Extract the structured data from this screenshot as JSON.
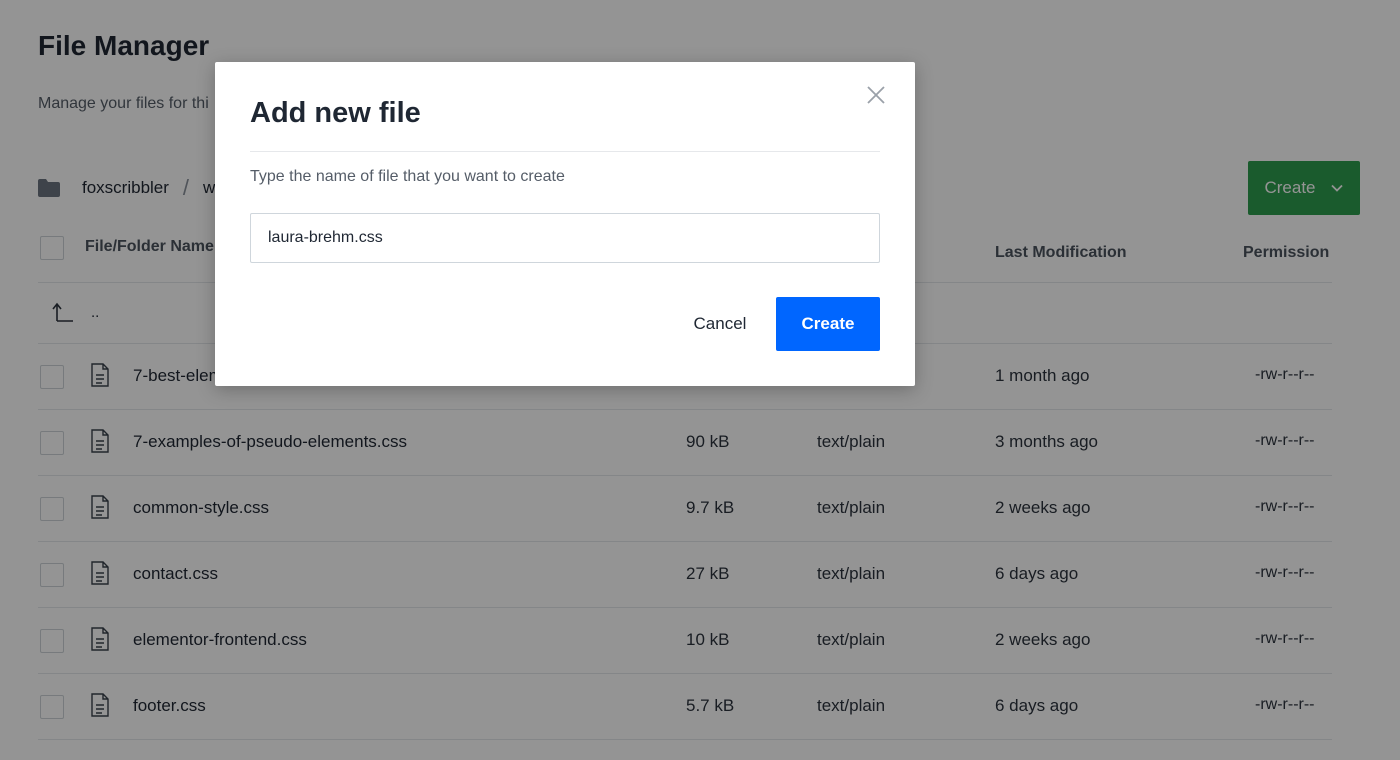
{
  "page": {
    "title": "File Manager",
    "subtitle": "Manage your files for thi"
  },
  "breadcrumb": {
    "items": [
      "foxscribbler",
      "w"
    ],
    "separator": "/"
  },
  "toolbar": {
    "create_label": "Create"
  },
  "table": {
    "headers": {
      "name": "File/Folder Name",
      "modified": "Last Modification",
      "permission": "Permission"
    },
    "parent_label": "..",
    "rows": [
      {
        "name": "7-best-elem",
        "size": "",
        "type": "",
        "modified": "1 month ago",
        "permission": "-rw-r--r--"
      },
      {
        "name": "7-examples-of-pseudo-elements.css",
        "size": "90 kB",
        "type": "text/plain",
        "modified": "3 months ago",
        "permission": "-rw-r--r--"
      },
      {
        "name": "common-style.css",
        "size": "9.7 kB",
        "type": "text/plain",
        "modified": "2 weeks ago",
        "permission": "-rw-r--r--"
      },
      {
        "name": "contact.css",
        "size": "27 kB",
        "type": "text/plain",
        "modified": "6 days ago",
        "permission": "-rw-r--r--"
      },
      {
        "name": "elementor-frontend.css",
        "size": "10 kB",
        "type": "text/plain",
        "modified": "2 weeks ago",
        "permission": "-rw-r--r--"
      },
      {
        "name": "footer.css",
        "size": "5.7 kB",
        "type": "text/plain",
        "modified": "6 days ago",
        "permission": "-rw-r--r--"
      }
    ]
  },
  "modal": {
    "title": "Add new file",
    "description": "Type the name of file that you want to create",
    "input_value": "laura-brehm.css",
    "cancel_label": "Cancel",
    "create_label": "Create"
  },
  "colors": {
    "primary": "#0066ff",
    "success": "#2e9e4f",
    "overlay": "rgba(0,0,0,0.42)"
  }
}
